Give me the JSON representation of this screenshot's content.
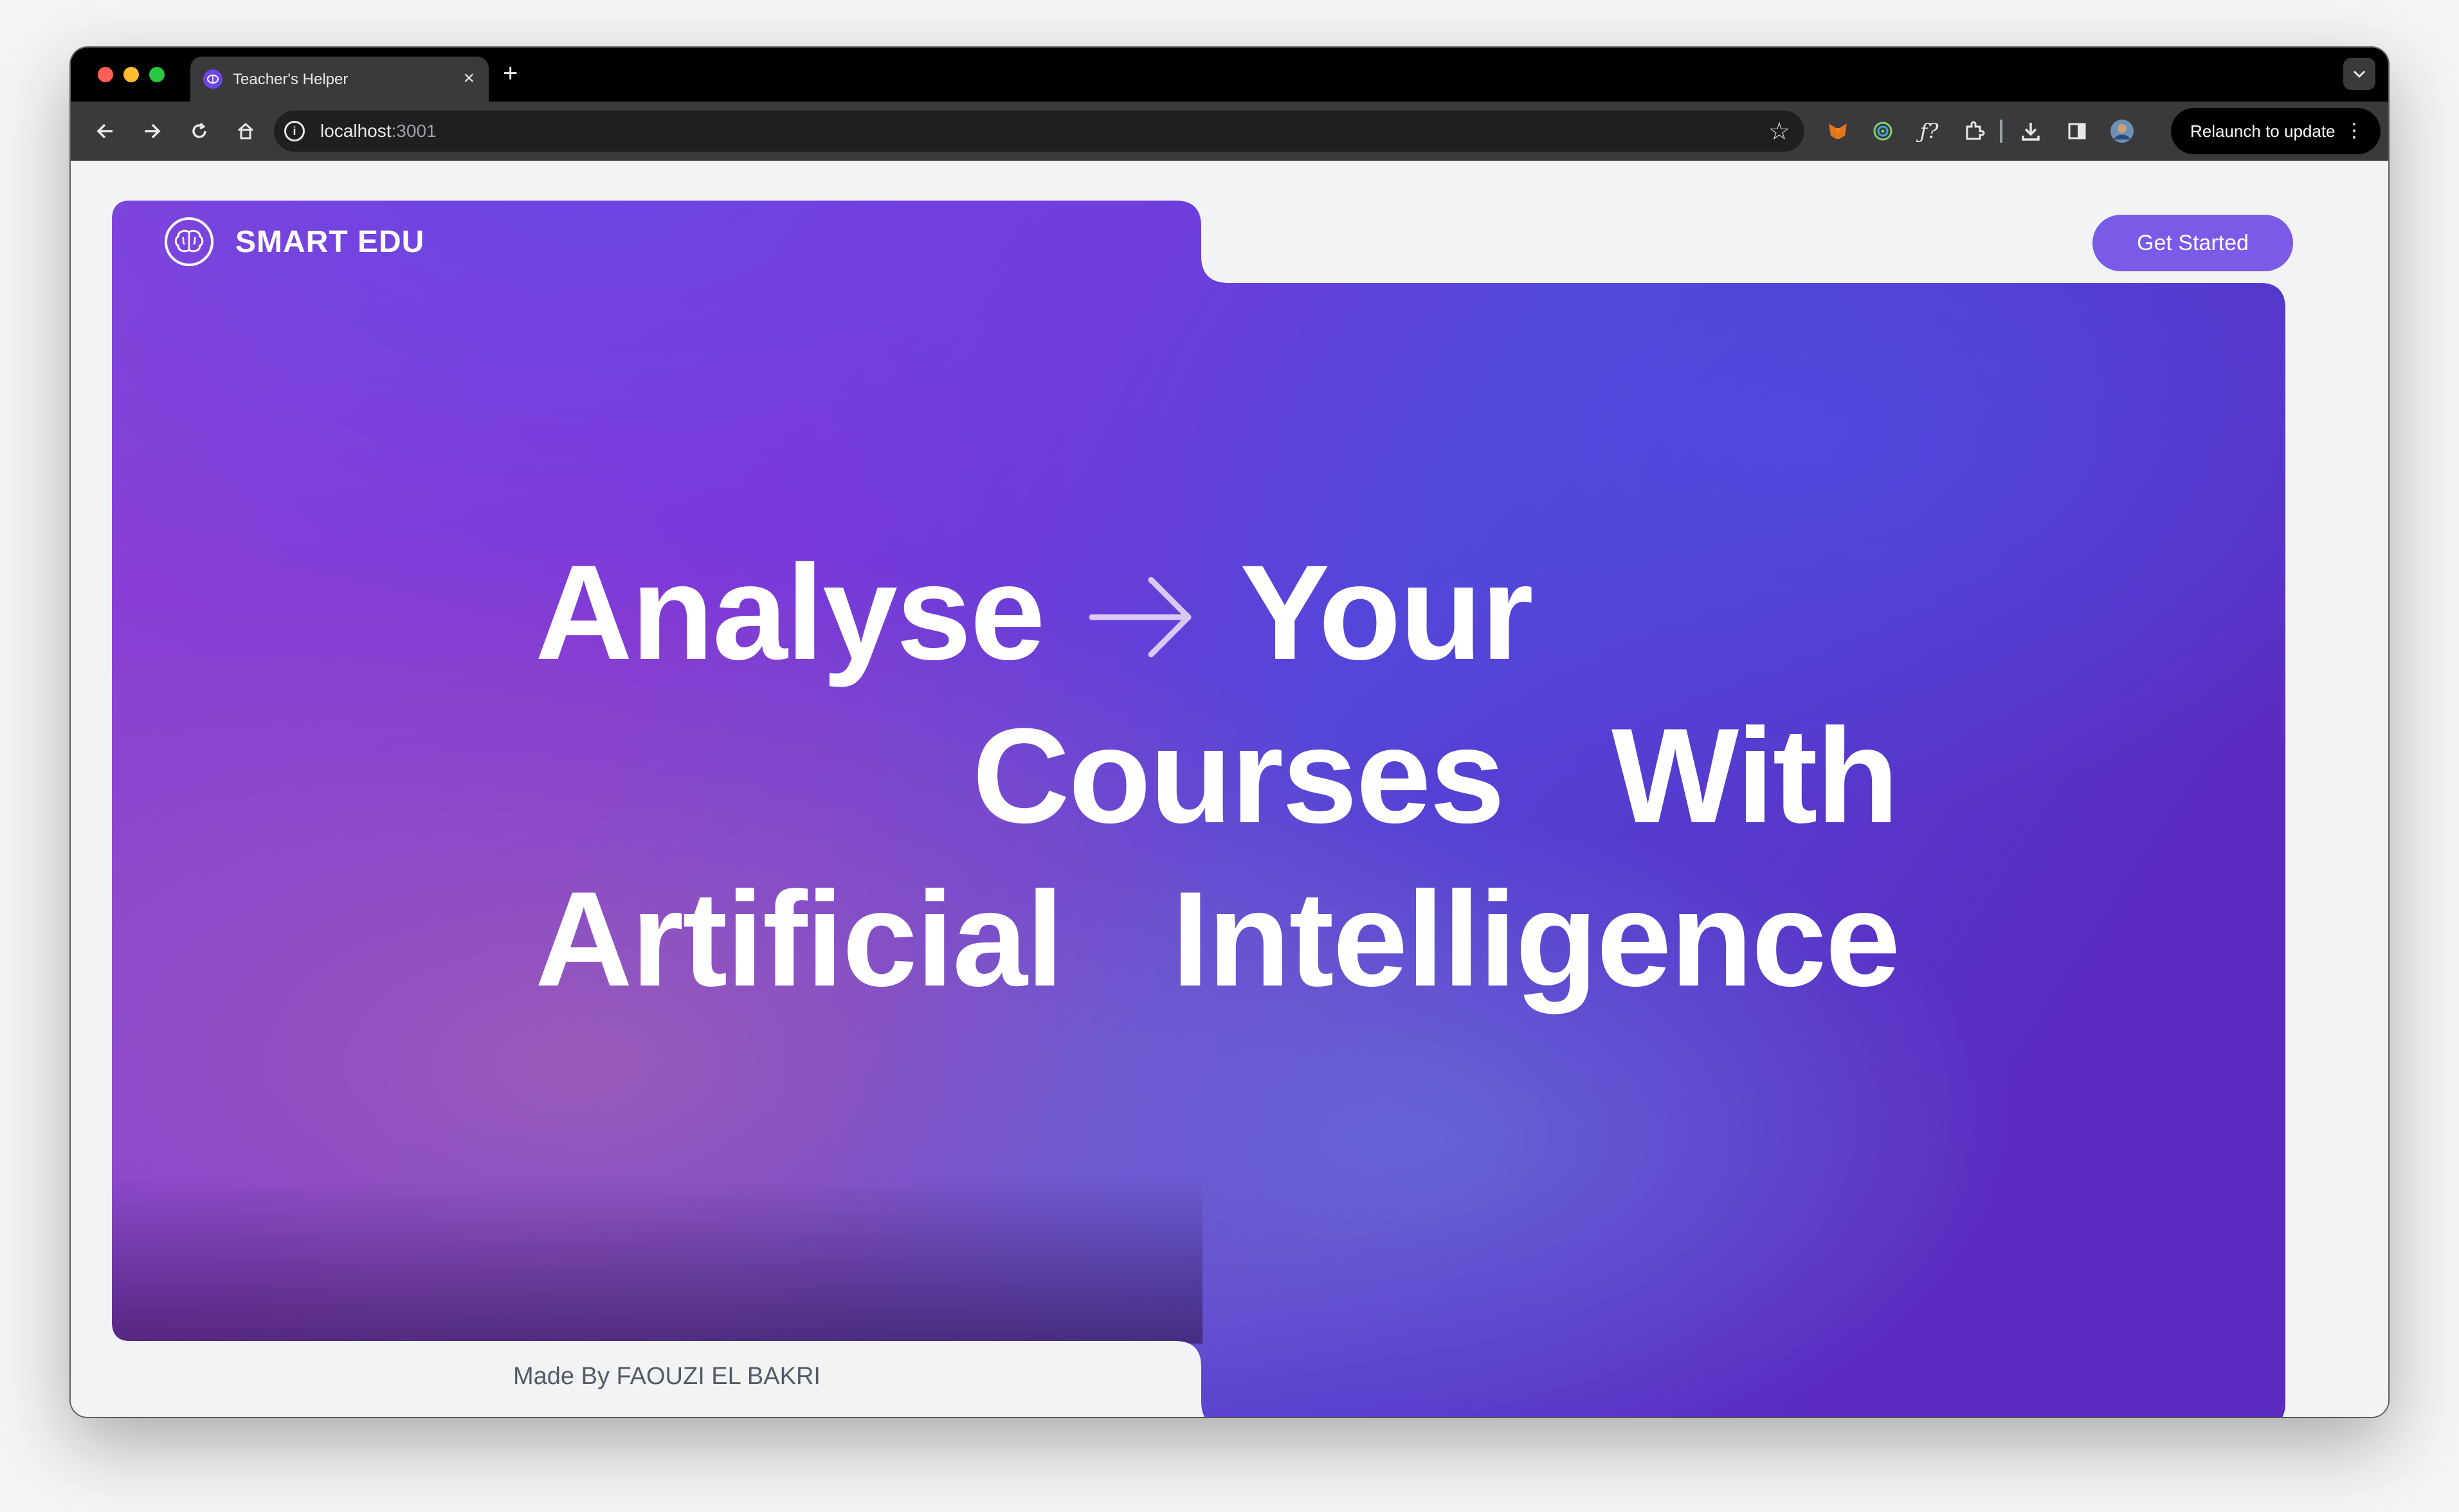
{
  "browser": {
    "tab_title": "Teacher's Helper",
    "tab_close": "×",
    "new_tab": "+",
    "url_host": "localhost",
    "url_port": ":3001",
    "relaunch_label": "Relaunch to update"
  },
  "nav": {
    "brand": "SMART EDU",
    "cta": "Get Started"
  },
  "hero": {
    "line1_word1": "Analyse",
    "line1_word2": "Your",
    "line2_word1": "Courses",
    "line2_word2": "With",
    "line3_word1": "Artificial",
    "line3_word2": "Intelligence"
  },
  "footer": {
    "credit": "Made By FAOUZI EL BAKRI"
  },
  "colors": {
    "accent": "#7a5ae6",
    "hero_violet": "#6f2fd6",
    "hero_blue": "#4f46e5",
    "hero_pink": "#9b4fc9"
  }
}
